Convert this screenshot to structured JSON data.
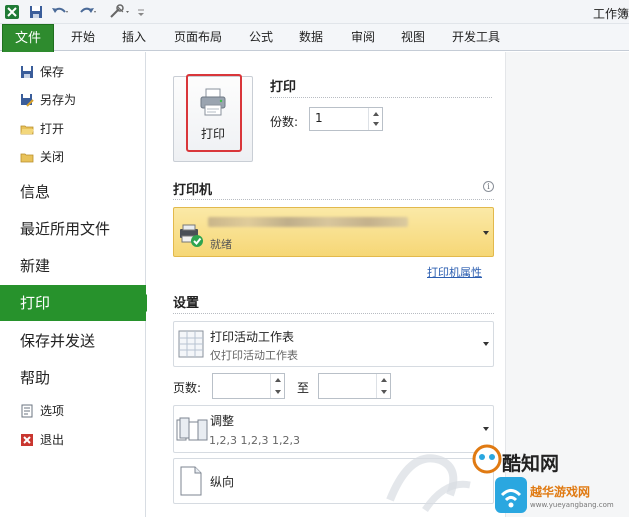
{
  "window": {
    "title": "工作簿"
  },
  "ribbon": {
    "tabs": [
      "文件",
      "开始",
      "插入",
      "页面布局",
      "公式",
      "数据",
      "审阅",
      "视图",
      "开发工具"
    ]
  },
  "nav": {
    "small_top": [
      "保存",
      "另存为",
      "打开",
      "关闭"
    ],
    "big": [
      "信息",
      "最近所用文件",
      "新建",
      "打印",
      "保存并发送",
      "帮助"
    ],
    "small_bottom": [
      "选项",
      "退出"
    ]
  },
  "print": {
    "button_label": "打印",
    "heading": "打印",
    "copies_label": "份数:",
    "copies_value": "1"
  },
  "printer": {
    "heading": "打印机",
    "status": "就绪",
    "properties_link": "打印机属性"
  },
  "settings": {
    "heading": "设置",
    "scope": {
      "title": "打印活动工作表",
      "subtitle": "仅打印活动工作表"
    },
    "pages_label": "页数:",
    "to_label": "至",
    "collate": {
      "title": "调整",
      "subtitle": "1,2,3    1,2,3    1,2,3"
    },
    "orientation": {
      "title": "纵向"
    }
  },
  "watermark": {
    "brand": "酷知网",
    "site_cn": "越华游戏网",
    "site_url": "www.yueyangbang.com"
  },
  "colors": {
    "file_tab": "#2e8b2e",
    "active_nav": "#27922c",
    "highlight_box": "#d9363a",
    "printer_fill": "#f6d776",
    "link": "#2a5db0"
  }
}
